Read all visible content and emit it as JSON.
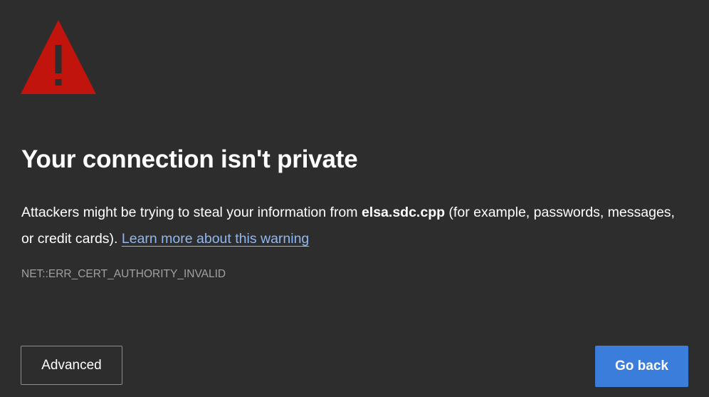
{
  "page": {
    "title": "Your connection isn't private",
    "message": {
      "prefix": "Attackers might be trying to steal your information from ",
      "host": "elsa.sdc.cpp",
      "suffix": " (for example, passwords, messages, or credit cards). ",
      "link_label": "Learn more about this warning"
    },
    "error_code": "NET::ERR_CERT_AUTHORITY_INVALID"
  },
  "buttons": {
    "advanced_label": "Advanced",
    "go_back_label": "Go back"
  },
  "icons": {
    "warning": "warning-triangle-icon"
  },
  "colors": {
    "background": "#2d2d2d",
    "warning_red": "#c0140c",
    "link": "#8fb8f0",
    "primary_button": "#3b7ddb"
  }
}
